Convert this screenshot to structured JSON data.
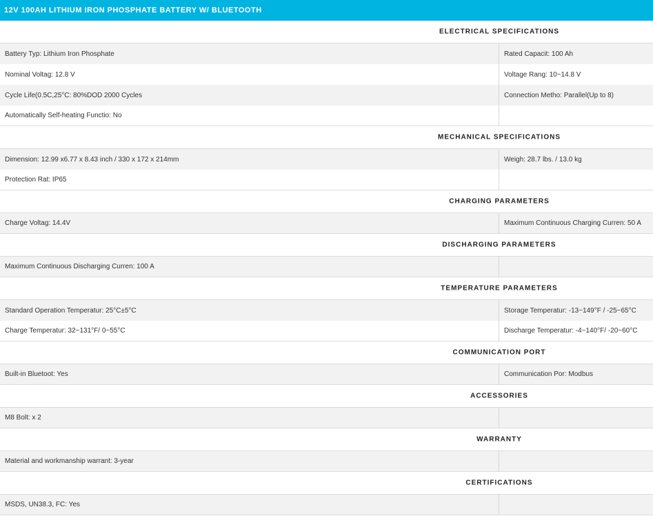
{
  "title": "12V 100AH LITHIUM IRON PHOSPHATE BATTERY W/ BLUETOOTH",
  "sections": [
    {
      "header": "ELECTRICAL SPECIFICATIONS",
      "rows": [
        {
          "left": "Battery Typ: Lithium Iron Phosphate",
          "right": "Rated Capacit: 100 Ah"
        },
        {
          "left": "Nominal Voltag: 12.8 V",
          "right": "Voltage Rang: 10~14.8 V"
        },
        {
          "left": "Cycle Life(0.5C,25°C: 80%DOD 2000 Cycles",
          "right": "Connection Metho: Parallel(Up to 8)"
        },
        {
          "left": "Automatically Self-heating Functio: No",
          "right": ""
        }
      ]
    },
    {
      "header": "MECHANICAL SPECIFICATIONS",
      "rows": [
        {
          "left": "Dimension: 12.99 x6.77 x 8.43 inch / 330 x 172 x 214mm",
          "right": "Weigh: 28.7 lbs. / 13.0 kg"
        },
        {
          "left": "Protection Rat: IP65",
          "right": ""
        }
      ]
    },
    {
      "header": "CHARGING PARAMETERS",
      "rows": [
        {
          "left": "Charge Voltag: 14.4V",
          "right": "Maximum Continuous Charging Curren: 50 A"
        }
      ]
    },
    {
      "header": "DISCHARGING PARAMETERS",
      "rows": [
        {
          "left": "Maximum Continuous Discharging Curren: 100 A",
          "right": ""
        }
      ]
    },
    {
      "header": "TEMPERATURE PARAMETERS",
      "rows": [
        {
          "left": "Standard Operation Temperatur: 25°C±5°C",
          "right": "Storage Temperatur: -13~149°F / -25~65°C"
        },
        {
          "left": "Charge Temperatur: 32~131°F/ 0~55°C",
          "right": "Discharge Temperatur: -4~140°F/ -20~60°C"
        }
      ]
    },
    {
      "header": "COMMUNICATION PORT",
      "rows": [
        {
          "left": "Built-in Bluetoot: Yes",
          "right": "Communication Por: Modbus"
        }
      ]
    },
    {
      "header": "ACCESSORIES",
      "rows": [
        {
          "left": "M8 Bolt: x 2",
          "right": ""
        }
      ]
    },
    {
      "header": "WARRANTY",
      "rows": [
        {
          "left": "Material and workmanship warrant: 3-year",
          "right": ""
        }
      ]
    },
    {
      "header": "CERTIFICATIONS",
      "rows": [
        {
          "left": "MSDS, UN38.3, FC: Yes",
          "right": ""
        }
      ]
    }
  ]
}
